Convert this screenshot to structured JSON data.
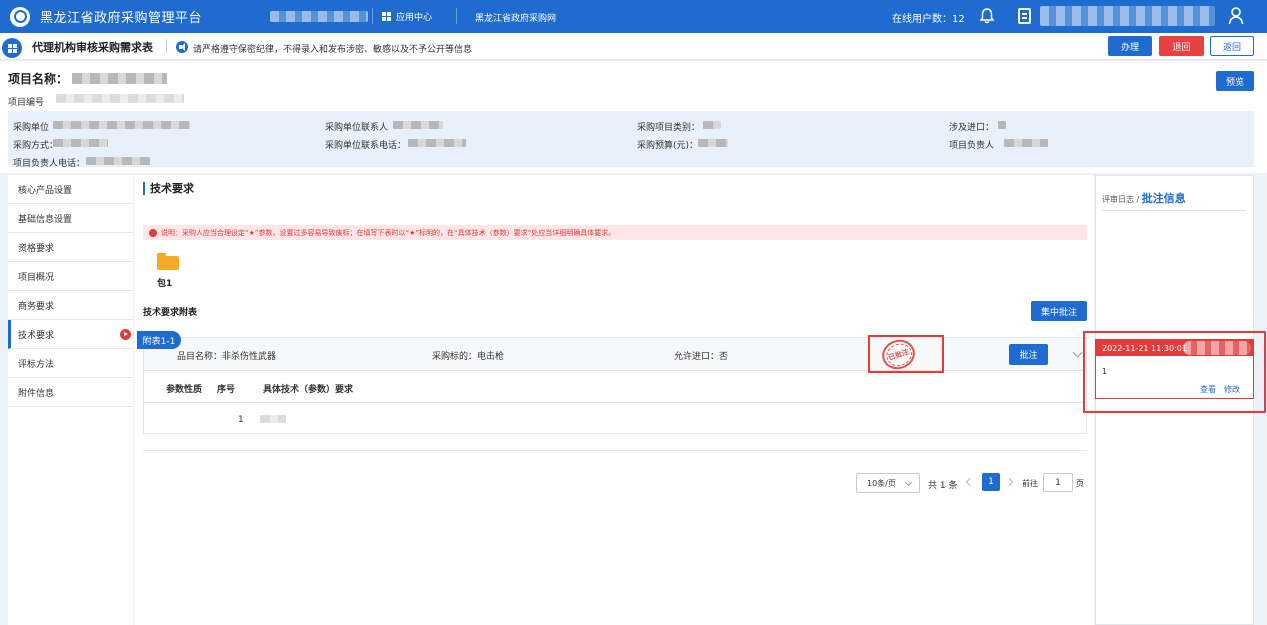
{
  "header": {
    "app_title": "黑龙江省政府采购管理平台",
    "app_center": "应用中心",
    "portal_link": "黑龙江省政府采购网",
    "online_users": "在线用户数：12"
  },
  "titlebar": {
    "page_title": "代理机构审核采购需求表",
    "notice": "请严格遵守保密纪律，不得录入和发布涉密、敏感以及不予公开等信息",
    "btn_handle": "办理",
    "btn_back": "退回",
    "btn_return": "返回"
  },
  "project": {
    "name_label": "项目名称：",
    "code_label": "项目编号",
    "btn_preview": "预览",
    "info": {
      "purchaser": "采购单位",
      "purchaser_contact": "采购单位联系人",
      "category": "采购项目类别：",
      "import": "涉及进口：",
      "method": "采购方式：",
      "contact_phone": "采购单位联系电话：",
      "budget": "采购预算(元)：",
      "manager": "项目负责人",
      "manager_phone": "项目负责人电话："
    }
  },
  "nav": {
    "items": [
      "核心产品设置",
      "基础信息设置",
      "资格要求",
      "项目概况",
      "商务要求",
      "技术要求",
      "评标方法",
      "附件信息"
    ],
    "active_index": 5
  },
  "main": {
    "section_title": "技术要求",
    "warning": "说明：采购人应当合理设定“★”参数，设置过多容易导致废标；在填写下表时以“★”标明的，在“具体技术（参数）要求”处应当详细明确具体要求。",
    "package_label": "包1",
    "attach_label": "技术要求附表",
    "btn_batch": "集中批注",
    "attach_tag": "附表1-1",
    "row": {
      "item_name": "品目名称：非杀伤性武器",
      "target": "采购标的：电击枪",
      "allow_import": "允许进口：否",
      "stamp": "已批注",
      "btn_annotate": "批注"
    },
    "columns": {
      "param_type": "参数性质",
      "seq": "序号",
      "requirement": "具体技术（参数）要求"
    },
    "first_row_seq": "1"
  },
  "pagination": {
    "page_size": "10条/页",
    "total": "共 1 条",
    "current": "1",
    "goto": "前往",
    "goto_value": "1",
    "page_unit": "页"
  },
  "right_panel": {
    "title_log": "评审日志",
    "title_sep": " / ",
    "title_annot": "批注信息",
    "log_time": "2022-11-21 11:30:01",
    "log_content": "1",
    "view": "查看",
    "edit": "修改"
  }
}
